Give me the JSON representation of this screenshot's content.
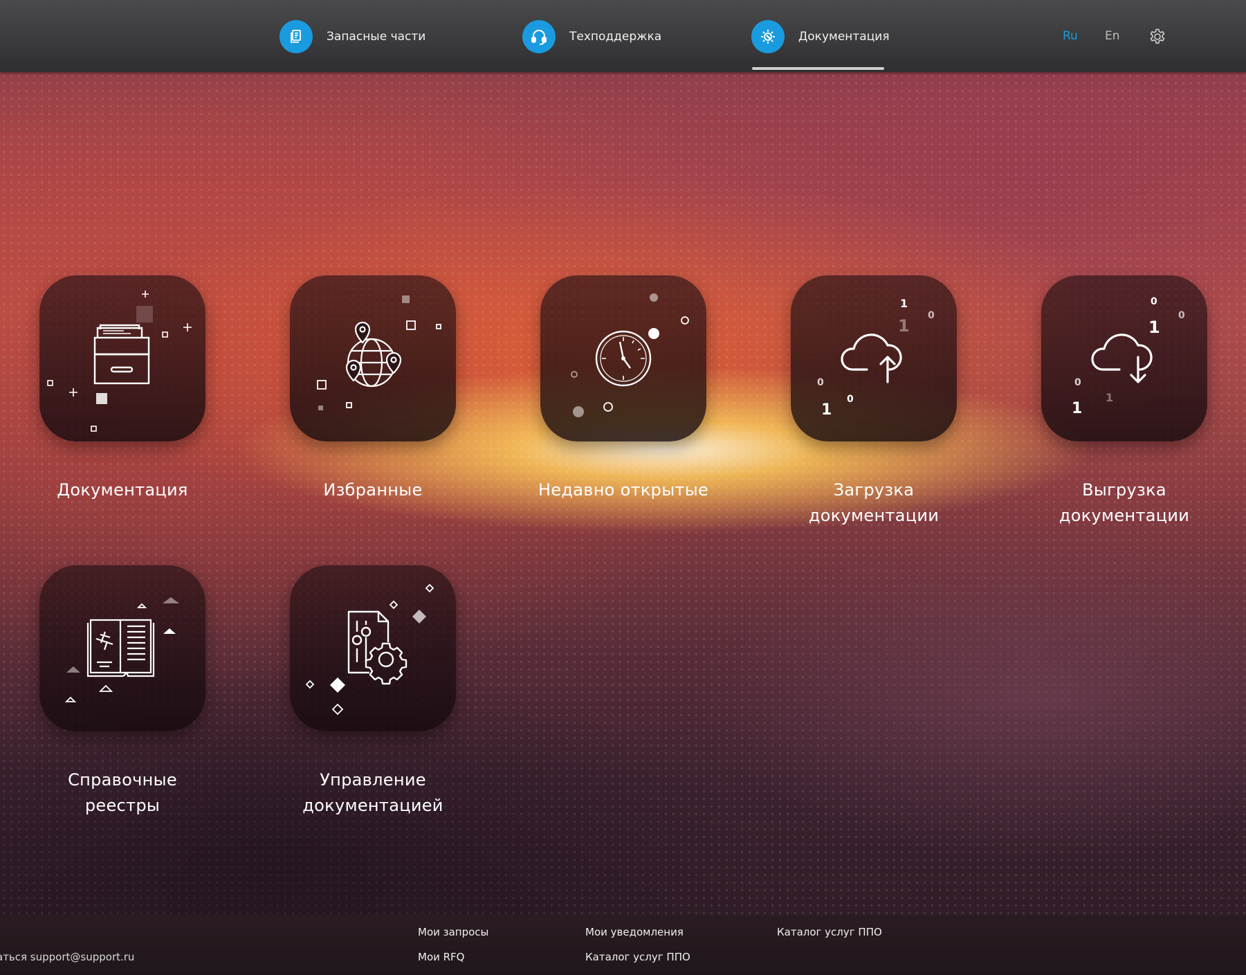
{
  "header": {
    "nav": [
      {
        "label": "Запасные части",
        "icon": "spare-parts-icon"
      },
      {
        "label": "Техподдержка",
        "icon": "headset-icon"
      },
      {
        "label": "Документация",
        "icon": "gear-wrench-icon",
        "active": true
      }
    ],
    "lang_ru": "Ru",
    "lang_en": "En",
    "active_lang": "Ru",
    "settings_icon": "gear-icon"
  },
  "tiles": [
    {
      "line1": "Документация",
      "line2": "",
      "icon": "file-drawer-icon"
    },
    {
      "line1": "Избранные",
      "line2": "",
      "icon": "globe-pins-icon"
    },
    {
      "line1": "Недавно открытые",
      "line2": "",
      "icon": "clock-icon"
    },
    {
      "line1": "Загрузка",
      "line2": "документации",
      "icon": "cloud-upload-icon"
    },
    {
      "line1": "Выгрузка",
      "line2": "документации",
      "icon": "cloud-download-icon"
    },
    {
      "line1": "Справочные",
      "line2": "реестры",
      "icon": "book-plane-icon"
    },
    {
      "line1": "Управление",
      "line2": "документацией",
      "icon": "document-settings-icon"
    }
  ],
  "footer": {
    "contact": "аться support@support.ru",
    "col1": [
      "Мои запросы",
      "Мои RFQ"
    ],
    "col2": [
      "Мои уведомления",
      "Каталог услуг ППО"
    ],
    "col3": [
      "Каталог услуг ППО"
    ]
  },
  "colors": {
    "accent": "#1a9be0",
    "lang_inactive": "#bdbdbd"
  }
}
